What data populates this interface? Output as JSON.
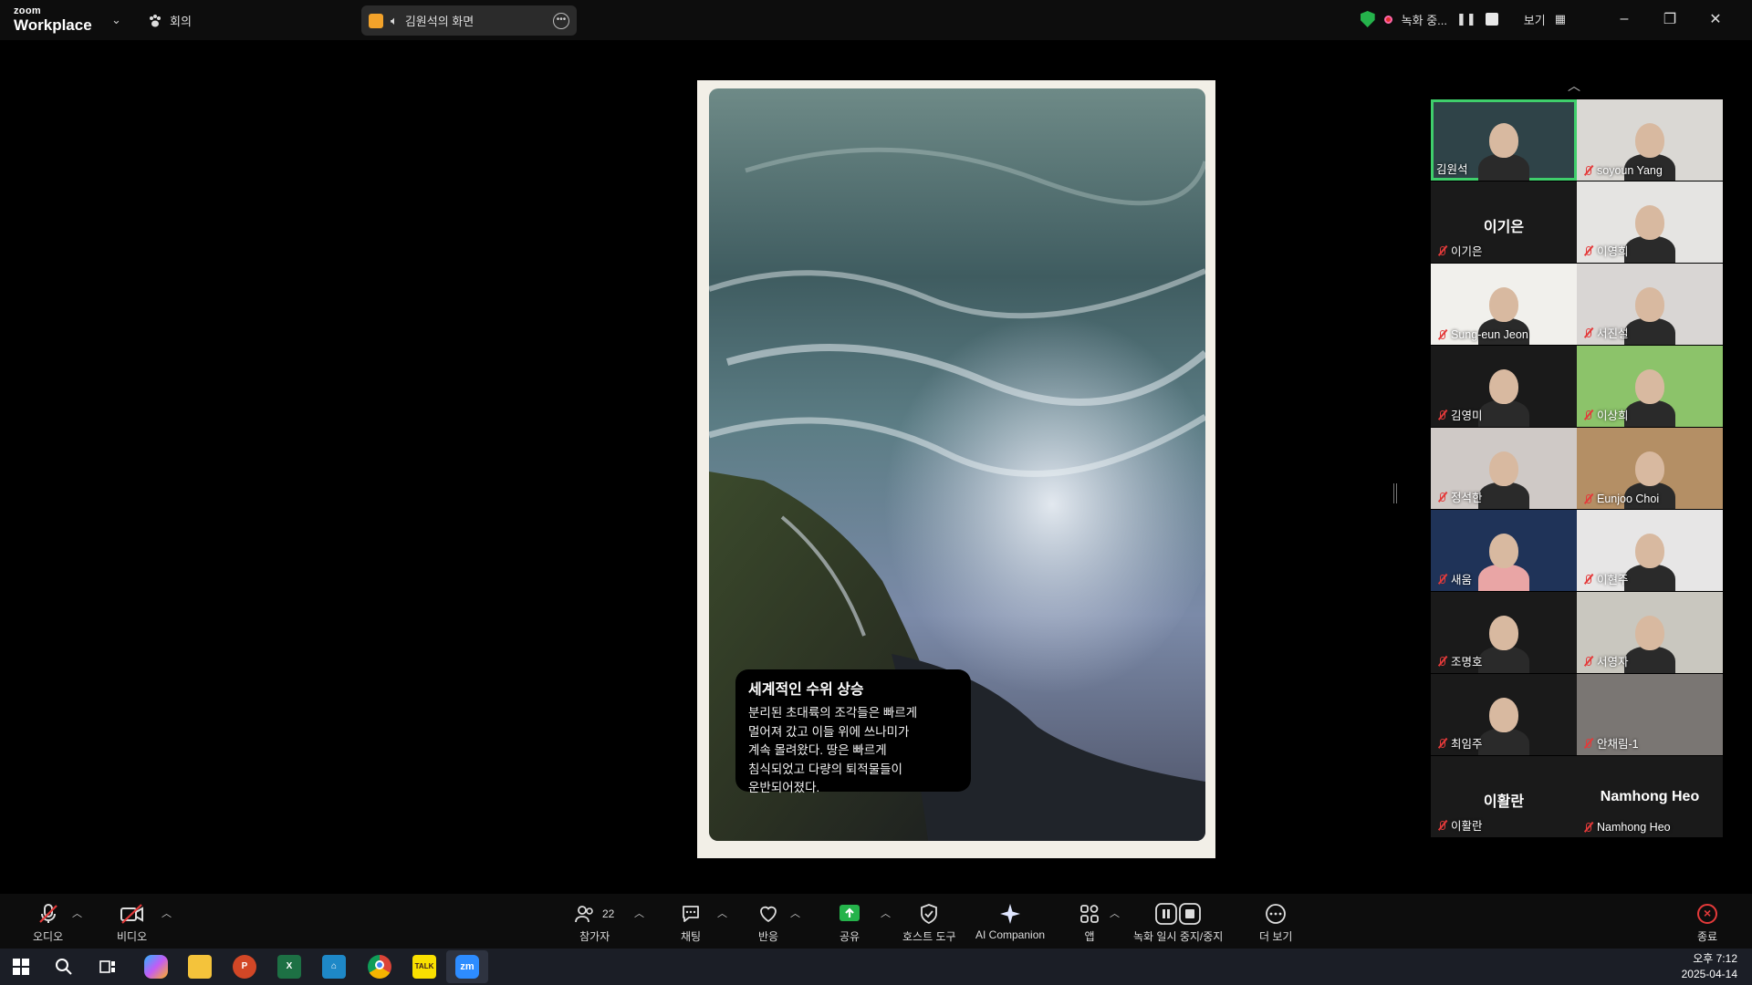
{
  "app": {
    "brand_small": "zoom",
    "brand_large": "Workplace",
    "meeting_label": "회의"
  },
  "share": {
    "label": "김원석의 화면"
  },
  "recording": {
    "status": "녹화 중...",
    "view_label": "보기"
  },
  "slide": {
    "caption_title": "세계적인 수위 상승",
    "caption_lines": [
      "분리된 초대륙의 조각들은 빠르게",
      "멀어져 갔고 이들 위에 쓰나미가",
      "계속 몰려왔다. 땅은 빠르게",
      "침식되었고 다량의 퇴적물들이",
      "운반되어졌다."
    ]
  },
  "participants": [
    {
      "name": "김원석",
      "muted": false,
      "active": true,
      "video": true
    },
    {
      "name": "soyoun Yang",
      "muted": true,
      "video": true
    },
    {
      "name": "이기은",
      "muted": true,
      "video": false,
      "display": "이기은"
    },
    {
      "name": "이영희",
      "muted": true,
      "video": true
    },
    {
      "name": "Sung-eun Jeon",
      "muted": true,
      "video": true
    },
    {
      "name": "서진설",
      "muted": true,
      "video": true
    },
    {
      "name": "김영미",
      "muted": true,
      "video": true
    },
    {
      "name": "이상희",
      "muted": true,
      "video": true
    },
    {
      "name": "정석한",
      "muted": true,
      "video": true
    },
    {
      "name": "Eunjoo Choi",
      "muted": true,
      "video": true
    },
    {
      "name": "새움",
      "muted": true,
      "video": true
    },
    {
      "name": "이현주",
      "muted": true,
      "video": true
    },
    {
      "name": "조명호",
      "muted": true,
      "video": true
    },
    {
      "name": "서영자",
      "muted": true,
      "video": true
    },
    {
      "name": "최임주",
      "muted": true,
      "video": true
    },
    {
      "name": "안채림-1",
      "muted": true,
      "video": true
    },
    {
      "name": "이활란",
      "muted": true,
      "video": false,
      "display": "이활란"
    },
    {
      "name": "Namhong Heo",
      "muted": true,
      "video": false,
      "display": "Namhong Heo"
    }
  ],
  "toolbar": {
    "audio": "오디오",
    "video": "비디오",
    "participants": "참가자",
    "participants_count": "22",
    "chat": "채팅",
    "reactions": "반응",
    "share": "공유",
    "host_tools": "호스트 도구",
    "ai": "AI Companion",
    "apps": "앱",
    "record": "녹화 일시 중지/중지",
    "more": "더 보기",
    "end": "종료"
  },
  "taskbar": {
    "time": "오후 7:12",
    "date": "2025-04-14"
  },
  "colors": {
    "share_green": "#25b34b",
    "muted_red": "#e43a3a",
    "active_border": "#3fce6b"
  }
}
